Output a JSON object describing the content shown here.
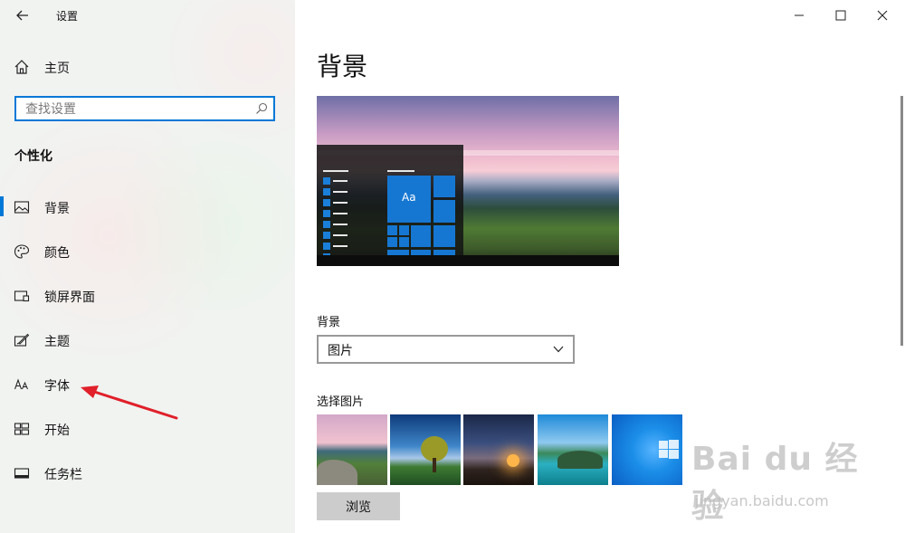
{
  "window": {
    "title": "设置",
    "controls": {
      "minimize": "minimize-icon",
      "maximize": "maximize-icon",
      "close": "close-icon"
    }
  },
  "sidebar": {
    "home_label": "主页",
    "search": {
      "placeholder": "查找设置",
      "value": ""
    },
    "section_title": "个性化",
    "items": [
      {
        "label": "背景",
        "icon": "picture-icon",
        "selected": true
      },
      {
        "label": "颜色",
        "icon": "palette-icon",
        "selected": false
      },
      {
        "label": "锁屏界面",
        "icon": "lock-screen-icon",
        "selected": false
      },
      {
        "label": "主题",
        "icon": "theme-brush-icon",
        "selected": false
      },
      {
        "label": "字体",
        "icon": "font-icon",
        "selected": false
      },
      {
        "label": "开始",
        "icon": "start-menu-icon",
        "selected": false
      },
      {
        "label": "任务栏",
        "icon": "taskbar-icon",
        "selected": false
      }
    ]
  },
  "main": {
    "title": "背景",
    "preview": {
      "tile_text": "Aa"
    },
    "background_label": "背景",
    "background_dropdown": {
      "selected": "图片"
    },
    "choose_picture_label": "选择图片",
    "browse_label": "浏览"
  },
  "watermark": {
    "logo": "Bai du 经验",
    "url": "jingyan.baidu.com"
  },
  "colors": {
    "accent": "#0078d7",
    "annotation_arrow": "#e0202a",
    "sidebar_bg": "#f1f3f1"
  }
}
